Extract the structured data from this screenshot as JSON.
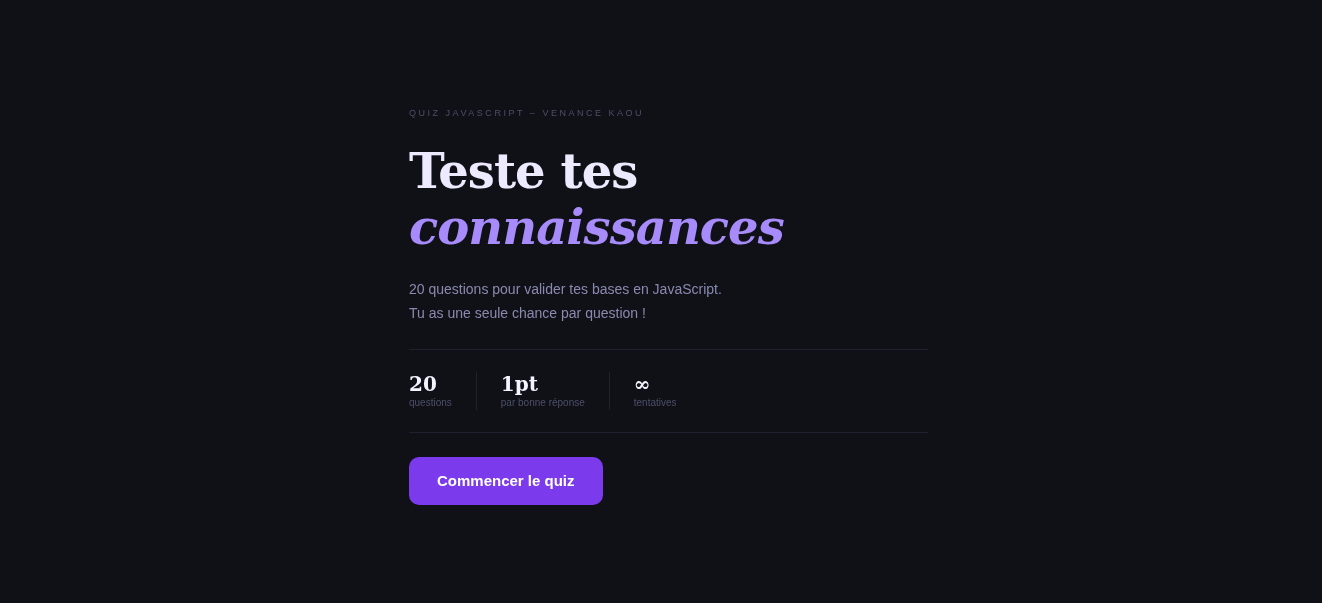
{
  "eyebrow": "QUIZ JAVASCRIPT – VENANCE KAOU",
  "title": {
    "line_1": "Teste tes",
    "line_2": "connaissances"
  },
  "description": [
    "20 questions pour valider tes bases en JavaScript.",
    "Tu as une seule chance par question !"
  ],
  "stats": [
    {
      "value": "20",
      "label": "questions"
    },
    {
      "value": "1pt",
      "label": "par bonne réponse"
    },
    {
      "value": "∞",
      "label": "tentatives"
    }
  ],
  "start_button": "Commencer le quiz"
}
